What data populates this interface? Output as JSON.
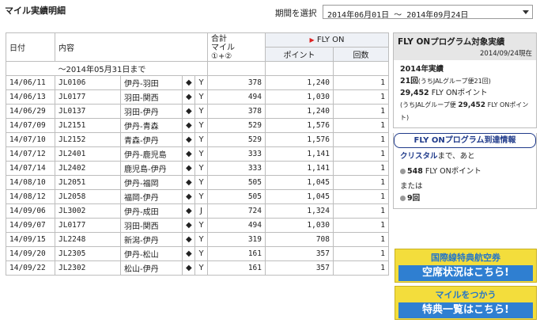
{
  "page": {
    "title": "マイル実績明細"
  },
  "period": {
    "label": "期間を選択",
    "value": "2014年06月01日 〜 2014年09月24日"
  },
  "table": {
    "headers": {
      "date": "日付",
      "content": "内容",
      "total_line1": "合計",
      "total_line2": "マイル",
      "total_line3": "①+②",
      "flyon": "FLY ON",
      "points": "ポイント",
      "count": "回数"
    },
    "prior_row": "〜2014年05月31日まで",
    "rows": [
      {
        "date": "14/06/11",
        "flight": "JL0106",
        "route": "伊丹-羽田",
        "mark": "◆",
        "cls": "Y",
        "miles": "378",
        "points": "1,240",
        "count": "1"
      },
      {
        "date": "14/06/13",
        "flight": "JL0177",
        "route": "羽田-関西",
        "mark": "◆",
        "cls": "Y",
        "miles": "494",
        "points": "1,030",
        "count": "1"
      },
      {
        "date": "14/06/29",
        "flight": "JL0137",
        "route": "羽田-伊丹",
        "mark": "◆",
        "cls": "Y",
        "miles": "378",
        "points": "1,240",
        "count": "1"
      },
      {
        "date": "14/07/09",
        "flight": "JL2151",
        "route": "伊丹-青森",
        "mark": "◆",
        "cls": "Y",
        "miles": "529",
        "points": "1,576",
        "count": "1"
      },
      {
        "date": "14/07/10",
        "flight": "JL2152",
        "route": "青森-伊丹",
        "mark": "◆",
        "cls": "Y",
        "miles": "529",
        "points": "1,576",
        "count": "1"
      },
      {
        "date": "14/07/12",
        "flight": "JL2401",
        "route": "伊丹-鹿児島",
        "mark": "◆",
        "cls": "Y",
        "miles": "333",
        "points": "1,141",
        "count": "1"
      },
      {
        "date": "14/07/14",
        "flight": "JL2402",
        "route": "鹿児島-伊丹",
        "mark": "◆",
        "cls": "Y",
        "miles": "333",
        "points": "1,141",
        "count": "1"
      },
      {
        "date": "14/08/10",
        "flight": "JL2051",
        "route": "伊丹-福岡",
        "mark": "◆",
        "cls": "Y",
        "miles": "505",
        "points": "1,045",
        "count": "1"
      },
      {
        "date": "14/08/12",
        "flight": "JL2058",
        "route": "福岡-伊丹",
        "mark": "◆",
        "cls": "Y",
        "miles": "505",
        "points": "1,045",
        "count": "1"
      },
      {
        "date": "14/09/06",
        "flight": "JL3002",
        "route": "伊丹-成田",
        "mark": "◆",
        "cls": "J",
        "miles": "724",
        "points": "1,324",
        "count": "1"
      },
      {
        "date": "14/09/07",
        "flight": "JL0177",
        "route": "羽田-関西",
        "mark": "◆",
        "cls": "Y",
        "miles": "494",
        "points": "1,030",
        "count": "1"
      },
      {
        "date": "14/09/15",
        "flight": "JL2248",
        "route": "新潟-伊丹",
        "mark": "◆",
        "cls": "Y",
        "miles": "319",
        "points": "708",
        "count": "1"
      },
      {
        "date": "14/09/20",
        "flight": "JL2305",
        "route": "伊丹-松山",
        "mark": "◆",
        "cls": "Y",
        "miles": "161",
        "points": "357",
        "count": "1"
      },
      {
        "date": "14/09/22",
        "flight": "JL2302",
        "route": "松山-伊丹",
        "mark": "◆",
        "cls": "Y",
        "miles": "161",
        "points": "357",
        "count": "1"
      }
    ]
  },
  "sidebar": {
    "header_title": "FLY ONプログラム対象実績",
    "header_date": "2014/09/24現在",
    "year_label": "2014年実績",
    "count_value": "21回",
    "count_note": "(うちJALグループ便21回)",
    "points_value": "29,452",
    "points_unit": " FLY ONポイント",
    "points_note": "(うちJALグループ便",
    "points_note_value": "29,452",
    "points_note_unit": " FLY ONポイント)",
    "info_button": "FLY ONプログラム到達情報",
    "crystal_label": "クリスタル",
    "crystal_suffix": "まで、あと",
    "remaining_points": "548",
    "remaining_unit": " FLY ONポイント",
    "or_label": "または",
    "remaining_count": "9回"
  },
  "banners": [
    {
      "line1": "国際線特典航空券",
      "line2": "空席状況はこちら!"
    },
    {
      "line1": "マイルをつかう",
      "line2": "特典一覧はこちら!"
    }
  ],
  "colors": {
    "header_bg": "#eef1f6",
    "accent_blue": "#1f3a8a",
    "banner_yellow": "#f3dd3c",
    "banner_blue": "#2f7fd1",
    "flyon_triangle": "#dd2222"
  },
  "icons": {
    "period_dropdown": "chevron-down-icon",
    "row_mark": "diamond-icon",
    "bullet": "dot-icon",
    "flyon_marker": "triangle-right-icon"
  }
}
